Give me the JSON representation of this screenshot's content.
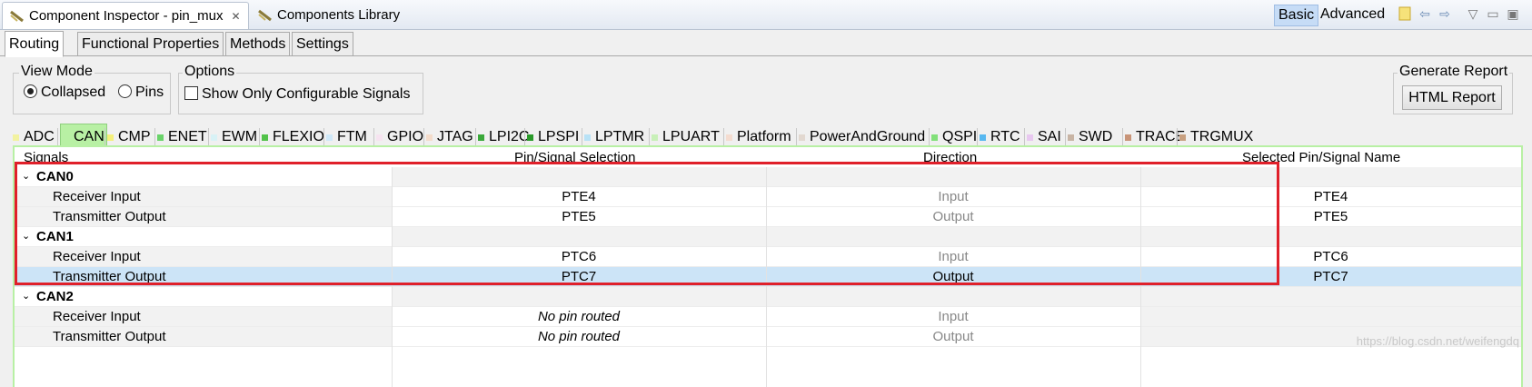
{
  "view_tabs": [
    {
      "label": "Component Inspector - pin_mux",
      "active": true
    },
    {
      "label": "Components Library",
      "active": false
    }
  ],
  "view_buttons": {
    "basic": "Basic",
    "advanced": "Advanced"
  },
  "subtabs": [
    "Routing",
    "Functional Properties",
    "Methods",
    "Settings"
  ],
  "view_mode": {
    "title": "View Mode",
    "collapsed": "Collapsed",
    "pins": "Pins"
  },
  "options": {
    "title": "Options",
    "show_only": "Show Only Configurable Signals"
  },
  "report": {
    "title": "Generate Report",
    "button": "HTML Report"
  },
  "peripheral_tabs": [
    {
      "label": "ADC",
      "color": "#f2f2a0"
    },
    {
      "label": "CAN",
      "color": "#b8f0a4"
    },
    {
      "label": "CMP",
      "color": "#f5f07a"
    },
    {
      "label": "ENET",
      "color": "#6ad36a"
    },
    {
      "label": "EWM",
      "color": "#d8f2f6"
    },
    {
      "label": "FLEXIO",
      "color": "#52c24a"
    },
    {
      "label": "FTM",
      "color": "#cfe8f8"
    },
    {
      "label": "GPIO",
      "color": "#f6e3f0"
    },
    {
      "label": "JTAG",
      "color": "#f4dccb"
    },
    {
      "label": "LPI2C",
      "color": "#3aa83a"
    },
    {
      "label": "LPSPI",
      "color": "#2a9a2a"
    },
    {
      "label": "LPTMR",
      "color": "#b8e2f6"
    },
    {
      "label": "LPUART",
      "color": "#c8f0b8"
    },
    {
      "label": "Platform",
      "color": "#f4dcd0"
    },
    {
      "label": "PowerAndGround",
      "color": "#e2d8d0"
    },
    {
      "label": "QSPI",
      "color": "#82e07a"
    },
    {
      "label": "RTC",
      "color": "#58b8f0"
    },
    {
      "label": "SAI",
      "color": "#e8c8f0"
    },
    {
      "label": "SWD",
      "color": "#c8b4a4"
    },
    {
      "label": "TRACE",
      "color": "#c89478"
    },
    {
      "label": "TRGMUX",
      "color": "#c8a080"
    }
  ],
  "table": {
    "headers": [
      "Signals",
      "Pin/Signal Selection",
      "Direction",
      "Selected Pin/Signal Name"
    ],
    "groups": [
      {
        "name": "CAN0",
        "rows": [
          {
            "signal": "Receiver Input",
            "pin": "PTE4",
            "dir": "Input",
            "name": "PTE4"
          },
          {
            "signal": "Transmitter Output",
            "pin": "PTE5",
            "dir": "Output",
            "name": "PTE5"
          }
        ]
      },
      {
        "name": "CAN1",
        "rows": [
          {
            "signal": "Receiver Input",
            "pin": "PTC6",
            "dir": "Input",
            "name": "PTC6"
          },
          {
            "signal": "Transmitter Output",
            "pin": "PTC7",
            "dir": "Output",
            "name": "PTC7"
          }
        ]
      },
      {
        "name": "CAN2",
        "rows": [
          {
            "signal": "Receiver Input",
            "pin": "No pin routed",
            "dir": "Input",
            "name": ""
          },
          {
            "signal": "Transmitter Output",
            "pin": "No pin routed",
            "dir": "Output",
            "name": ""
          }
        ]
      }
    ]
  },
  "watermark": "https://blog.csdn.net/weifengdq"
}
